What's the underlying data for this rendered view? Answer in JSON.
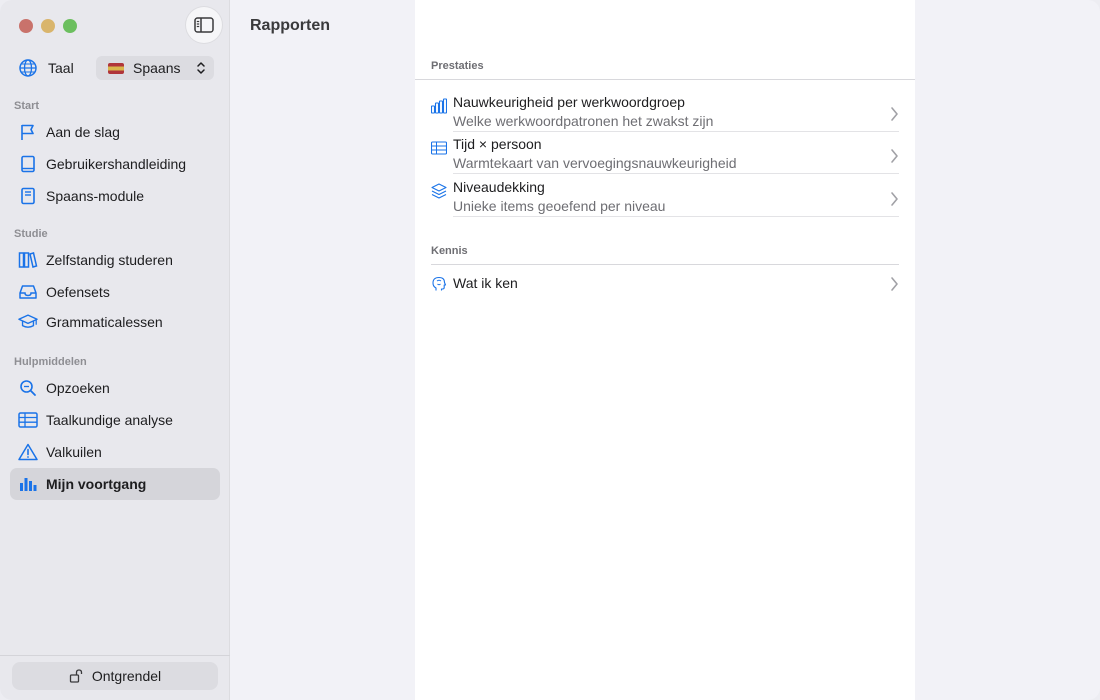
{
  "window": {
    "title": "Rapporten"
  },
  "sidebar": {
    "language": {
      "label": "Taal",
      "selected": "Spaans"
    },
    "sections": [
      {
        "label": "Start",
        "items": [
          {
            "label": "Aan de slag",
            "icon": "flag-icon"
          },
          {
            "label": "Gebruikershandleiding",
            "icon": "book-icon"
          },
          {
            "label": "Spaans-module",
            "icon": "book-closed-icon"
          }
        ]
      },
      {
        "label": "Studie",
        "items": [
          {
            "label": "Zelfstandig studeren",
            "icon": "books-icon"
          },
          {
            "label": "Oefensets",
            "icon": "tray-icon"
          },
          {
            "label": "Grammaticalessen",
            "icon": "graduation-cap-icon"
          }
        ]
      },
      {
        "label": "Hulpmiddelen",
        "items": [
          {
            "label": "Opzoeken",
            "icon": "magnifier-icon"
          },
          {
            "label": "Taalkundige analyse",
            "icon": "table-icon"
          },
          {
            "label": "Valkuilen",
            "icon": "warning-icon"
          },
          {
            "label": "Mijn voortgang",
            "icon": "bar-chart-icon",
            "active": true
          }
        ]
      }
    ],
    "unlock_label": "Ontgrendel"
  },
  "content": {
    "groups": [
      {
        "label": "Prestaties",
        "rows": [
          {
            "title": "Nauwkeurigheid per werkwoordgroep",
            "subtitle": "Welke werkwoordpatronen het zwakst zijn",
            "icon": "bar-chart-icon"
          },
          {
            "title": "Tijd × persoon",
            "subtitle": "Warmtekaart van vervoegingsnauwkeurigheid",
            "icon": "table-icon"
          },
          {
            "title": "Niveaudekking",
            "subtitle": "Unieke items geoefend per niveau",
            "icon": "layers-icon"
          }
        ]
      },
      {
        "label": "Kennis",
        "rows": [
          {
            "title": "Wat ik ken",
            "subtitle": "",
            "icon": "brain-icon"
          }
        ]
      }
    ]
  },
  "colors": {
    "accent": "#1a73e8",
    "sidebar_bg": "#e8e8ed",
    "content_bg": "#ffffff"
  }
}
